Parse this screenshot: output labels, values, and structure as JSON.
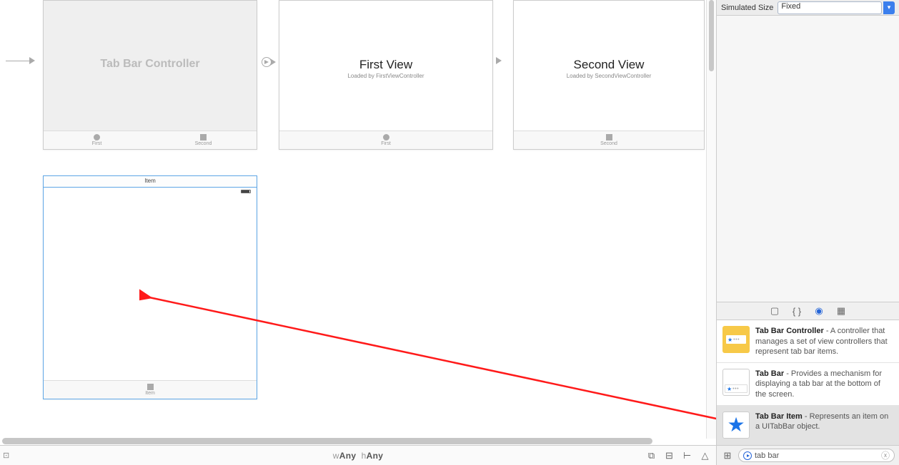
{
  "inspector": {
    "simulatedSizeLabel": "Simulated Size",
    "simulatedSizeValue": "Fixed"
  },
  "scenes": {
    "tabBarController": {
      "title": "Tab Bar Controller",
      "tabs": [
        "First",
        "Second"
      ]
    },
    "firstView": {
      "title": "First View",
      "subtitle": "Loaded by FirstViewController",
      "tab": "First"
    },
    "secondView": {
      "title": "Second View",
      "subtitle": "Loaded by SecondViewController",
      "tab": "Second"
    },
    "newScene": {
      "header": "Item",
      "tab": "Item"
    }
  },
  "sizeClass": {
    "w": "Any",
    "h": "Any",
    "prefixW": "w",
    "prefixH": "h"
  },
  "library": {
    "items": [
      {
        "title": "Tab Bar Controller",
        "desc": " - A controller that manages a set of view controllers that represent tab bar items."
      },
      {
        "title": "Tab Bar",
        "desc": " - Provides a mechanism for displaying a tab bar at the bottom of the screen."
      },
      {
        "title": "Tab Bar Item",
        "desc": " - Represents an item on a UITabBar object."
      }
    ],
    "search": "tab bar"
  }
}
